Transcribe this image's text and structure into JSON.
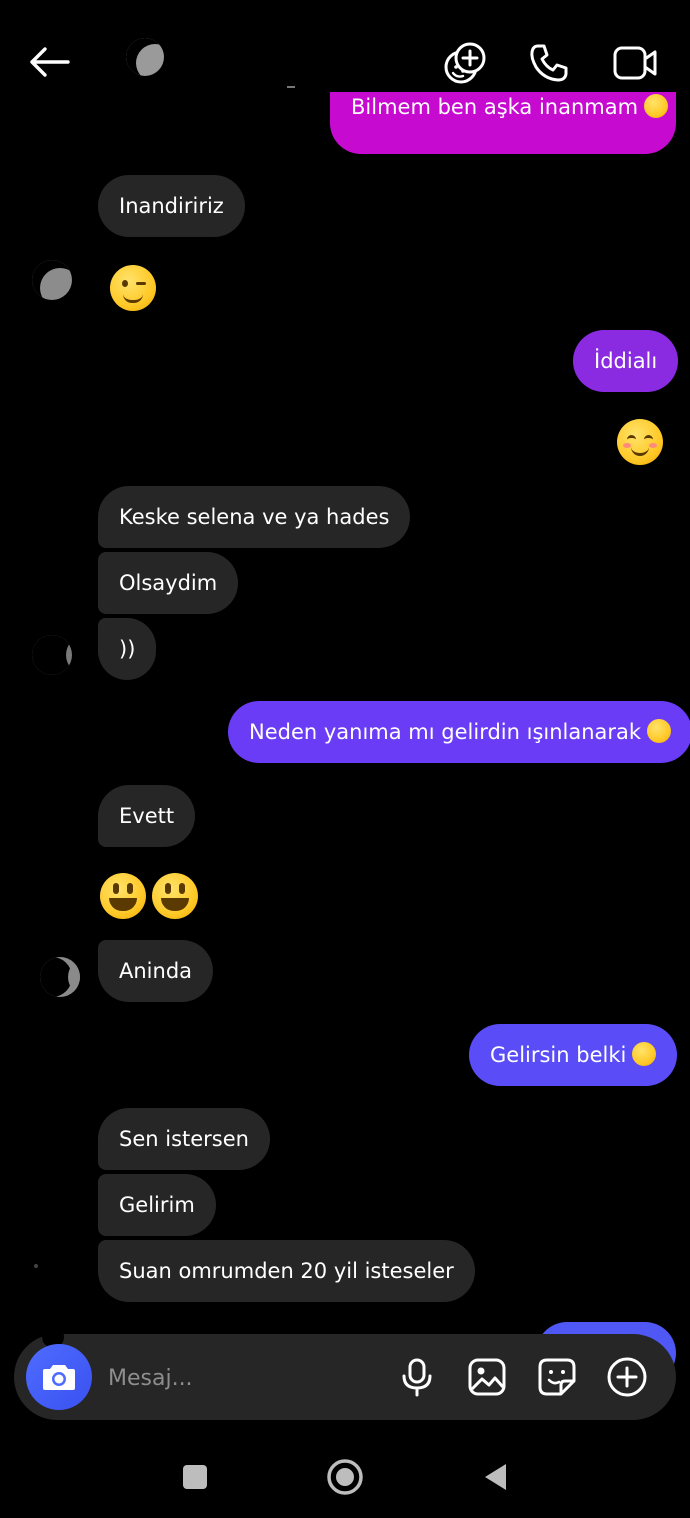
{
  "colors": {
    "background": "#000000",
    "incoming_bubble": "#262626",
    "outgoing_gradient": [
      "#c70ad0",
      "#8a2be2",
      "#6a3cf5",
      "#5a4cf6"
    ],
    "composer_bg": "#262626",
    "camera_button": "#4e6cff",
    "placeholder": "#8e8e8e"
  },
  "header": {
    "back_icon": "arrow-left-icon",
    "avatar": "crescent-moon-avatar",
    "actions": [
      "add-effects-icon",
      "phone-icon",
      "video-camera-icon"
    ]
  },
  "messages": [
    {
      "side": "out",
      "text": "Bilmem ben aşka inanmam",
      "emoji": "grinning-face-with-smiling-eyes"
    },
    {
      "side": "in",
      "text": "Inandiririz"
    },
    {
      "side": "in",
      "emoji_only": "winking-face"
    },
    {
      "side": "out",
      "text": "İddialı"
    },
    {
      "side": "out",
      "emoji_only": "smiling-face"
    },
    {
      "side": "in",
      "text": "Keske selena ve ya hades"
    },
    {
      "side": "in",
      "text": "Olsaydim"
    },
    {
      "side": "in",
      "text": "))"
    },
    {
      "side": "out",
      "text": "Neden yanıma mı gelirdin ışınlanarak",
      "emoji": "rolling-on-the-floor-laughing"
    },
    {
      "side": "in",
      "text": "Evett"
    },
    {
      "side": "in",
      "emoji_only": "grinning-face-big-eyes x2"
    },
    {
      "side": "in",
      "text": "Aninda"
    },
    {
      "side": "out",
      "text": "Gelirsin belki",
      "emoji": "upside-down-face"
    },
    {
      "side": "in",
      "text": "Sen istersen"
    },
    {
      "side": "in",
      "text": "Gelirim"
    },
    {
      "side": "in",
      "text": "Suan omrumden 20 yil isteseler"
    }
  ],
  "composer": {
    "placeholder": "Mesaj...",
    "icons": [
      "camera-icon",
      "microphone-icon",
      "gallery-icon",
      "sticker-icon",
      "plus-circle-icon"
    ]
  },
  "navbar": {
    "icons": [
      "recents-square-icon",
      "home-circle-icon",
      "back-triangle-icon"
    ]
  }
}
